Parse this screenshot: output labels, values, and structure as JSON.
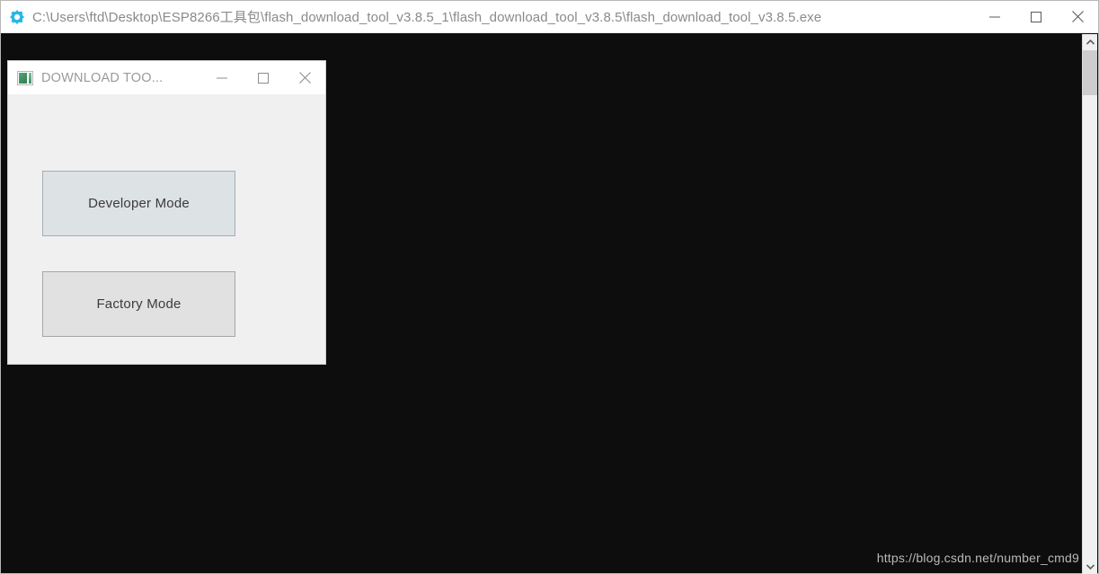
{
  "console_window": {
    "icon": "gear-icon",
    "title": "C:\\Users\\ftd\\Desktop\\ESP8266工具包\\flash_download_tool_v3.8.5_1\\flash_download_tool_v3.8.5\\flash_download_tool_v3.8.5.exe",
    "controls": {
      "minimize_label": "Minimize",
      "maximize_label": "Maximize",
      "close_label": "Close"
    },
    "background_color": "#0d0d0d"
  },
  "scrollbar": {
    "up_arrow": "chevron-up-icon",
    "down_arrow": "chevron-down-icon",
    "thumb_label": "Scroll thumb"
  },
  "watermark": {
    "text": "https://blog.csdn.net/number_cmd9"
  },
  "dialog": {
    "icon": "download-tool-icon",
    "title": "DOWNLOAD TOO...",
    "controls": {
      "minimize_label": "Minimize",
      "maximize_label": "Maximize",
      "close_label": "Close"
    },
    "buttons": [
      {
        "id": "developer-mode",
        "label": "Developer Mode",
        "background_color": "#dde2e5",
        "border_color": "#a3aeb8"
      },
      {
        "id": "factory-mode",
        "label": "Factory Mode",
        "background_color": "#e1e1e1",
        "border_color": "#a6a6a6"
      }
    ]
  }
}
